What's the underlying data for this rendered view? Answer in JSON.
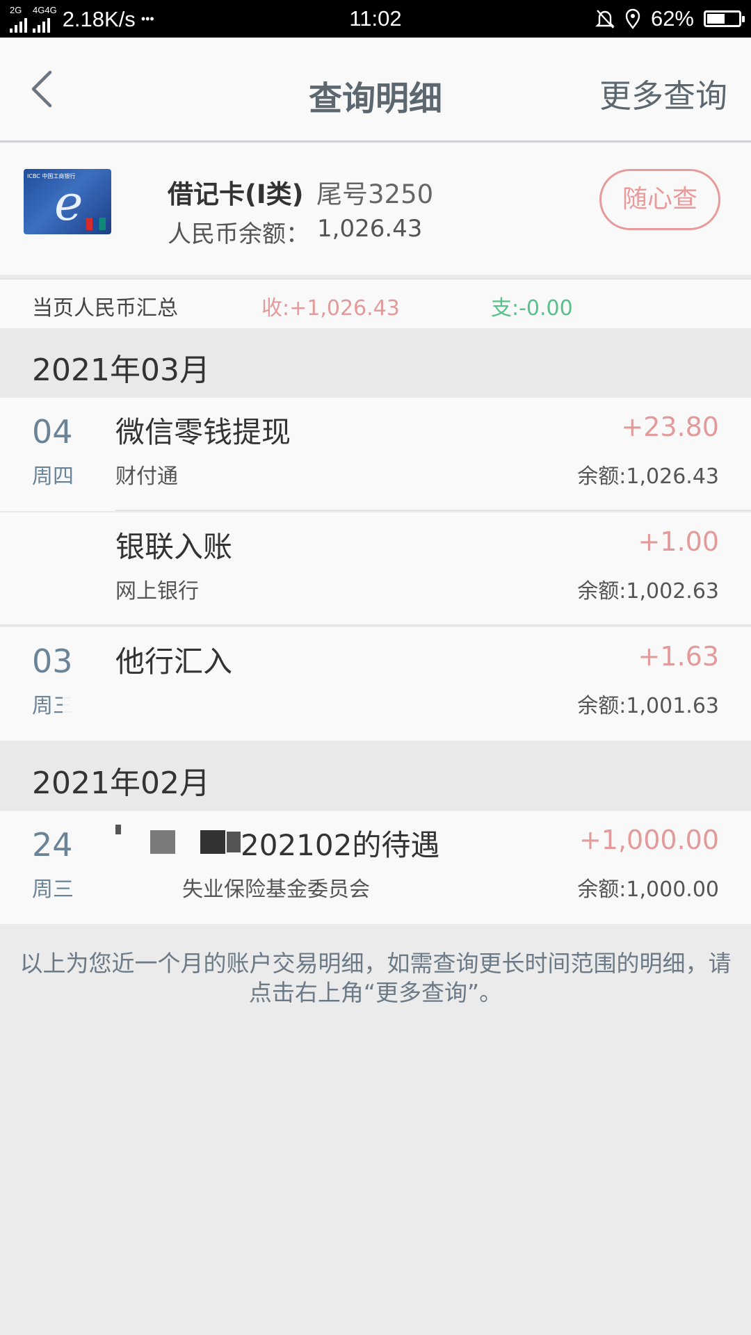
{
  "status_bar": {
    "network_1": "2G",
    "network_2": "4G",
    "network_3": "4G",
    "speed": "2.18K/s",
    "dots": "•••",
    "time": "11:02",
    "battery_pct": "62%",
    "battery_level": 0.62
  },
  "nav": {
    "title": "查询明细",
    "more": "更多查询"
  },
  "card": {
    "logo_text": "ICBC 中国工商银行",
    "name": "借记卡(I类)",
    "tail": "尾号3250",
    "balance_label": "人民币余额：",
    "balance_value": "1,026.43",
    "button": "随心查"
  },
  "summary": {
    "label": "当页人民币汇总",
    "income": "收:+1,026.43",
    "expense": "支:-0.00"
  },
  "months": [
    {
      "label": "2021年03月",
      "entries": [
        {
          "day": "04",
          "week": "周四",
          "title": "微信零钱提现",
          "sub": "财付通",
          "amount": "+23.80",
          "balance": "余额:1,026.43"
        },
        {
          "day": "",
          "week": "",
          "title": "银联入账",
          "sub": "网上银行",
          "amount": "+1.00",
          "balance": "余额:1,002.63"
        },
        {
          "day": "03",
          "week": "周三",
          "title": "他行汇入",
          "sub": "",
          "amount": "+1.63",
          "balance": "余额:1,001.63"
        }
      ]
    },
    {
      "label": "2021年02月",
      "entries": [
        {
          "day": "24",
          "week": "周三",
          "title": "202102的待遇",
          "sub": "失业保险基金委员会",
          "amount": "+1,000.00",
          "balance": "余额:1,000.00"
        }
      ]
    }
  ],
  "footer": "以上为您近一个月的账户交易明细，如需查询更长时间范围的明细，请点击右上角“更多查询”。",
  "colors": {
    "income": "#e39a9a",
    "expense": "#58c08a",
    "accent_text": "#5c6770",
    "date_text": "#6b8397"
  }
}
